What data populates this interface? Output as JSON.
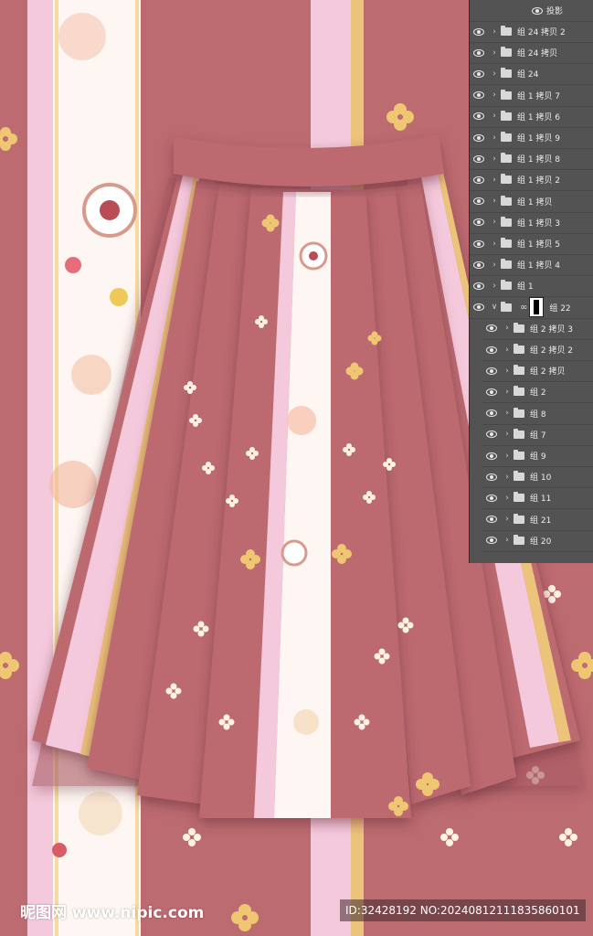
{
  "canvas": {
    "background_color": "#bc6b70",
    "stripe_pink": "#f5c9dc",
    "stripe_gold": "#ecc37a",
    "stripe_white": "#fdf6f2",
    "flower_color": "#efc671"
  },
  "skirt": {
    "waistband_color": "#bc6b70",
    "panel_color": "#bc6b70",
    "shadow_color": "#7a3a44",
    "trim_pink": "#f5c9dc",
    "trim_gold": "#ecc37a",
    "small_flower_color": "#fff5e8"
  },
  "layers_panel": {
    "top_item": {
      "label": "投影",
      "icon": "eye-icon"
    },
    "items": [
      {
        "label": "组 24 拷贝 2",
        "icon": "folder-icon",
        "expanded": false
      },
      {
        "label": "组 24 拷贝",
        "icon": "folder-icon",
        "expanded": false
      },
      {
        "label": "组 24",
        "icon": "folder-icon",
        "expanded": false
      },
      {
        "label": "组 1 拷贝 7",
        "icon": "folder-icon",
        "expanded": false
      },
      {
        "label": "组 1 拷贝 6",
        "icon": "folder-icon",
        "expanded": false
      },
      {
        "label": "组 1 拷贝 9",
        "icon": "folder-icon",
        "expanded": false
      },
      {
        "label": "组 1 拷贝 8",
        "icon": "folder-icon",
        "expanded": false
      },
      {
        "label": "组 1 拷贝 2",
        "icon": "folder-icon",
        "expanded": false
      },
      {
        "label": "组 1 拷贝",
        "icon": "folder-icon",
        "expanded": false
      },
      {
        "label": "组 1 拷贝 3",
        "icon": "folder-icon",
        "expanded": false
      },
      {
        "label": "组 1 拷贝 5",
        "icon": "folder-icon",
        "expanded": false
      },
      {
        "label": "组 1 拷贝 4",
        "icon": "folder-icon",
        "expanded": false
      },
      {
        "label": "组 1",
        "icon": "folder-icon",
        "expanded": false
      },
      {
        "label": "组 22",
        "icon": "folder-icon",
        "expanded": true,
        "has_mask": true
      },
      {
        "label": "组 2 拷贝 3",
        "icon": "folder-icon",
        "expanded": false,
        "child": true
      },
      {
        "label": "组 2 拷贝 2",
        "icon": "folder-icon",
        "expanded": false,
        "child": true
      },
      {
        "label": "组 2 拷贝",
        "icon": "folder-icon",
        "expanded": false,
        "child": true
      },
      {
        "label": "组 2",
        "icon": "folder-icon",
        "expanded": false,
        "child": true
      },
      {
        "label": "组 8",
        "icon": "folder-icon",
        "expanded": false,
        "child": true
      },
      {
        "label": "组 7",
        "icon": "folder-icon",
        "expanded": false,
        "child": true
      },
      {
        "label": "组 9",
        "icon": "folder-icon",
        "expanded": false,
        "child": true
      },
      {
        "label": "组 10",
        "icon": "folder-icon",
        "expanded": false,
        "child": true
      },
      {
        "label": "组 11",
        "icon": "folder-icon",
        "expanded": false,
        "child": true
      },
      {
        "label": "组 21",
        "icon": "folder-icon",
        "expanded": false,
        "child": true
      },
      {
        "label": "组 20",
        "icon": "folder-icon",
        "expanded": false,
        "child": true
      }
    ]
  },
  "watermark": {
    "logo_text": "昵图网 www.nipic.com",
    "id_text": "ID:32428192 NO:20240812111835860101"
  }
}
